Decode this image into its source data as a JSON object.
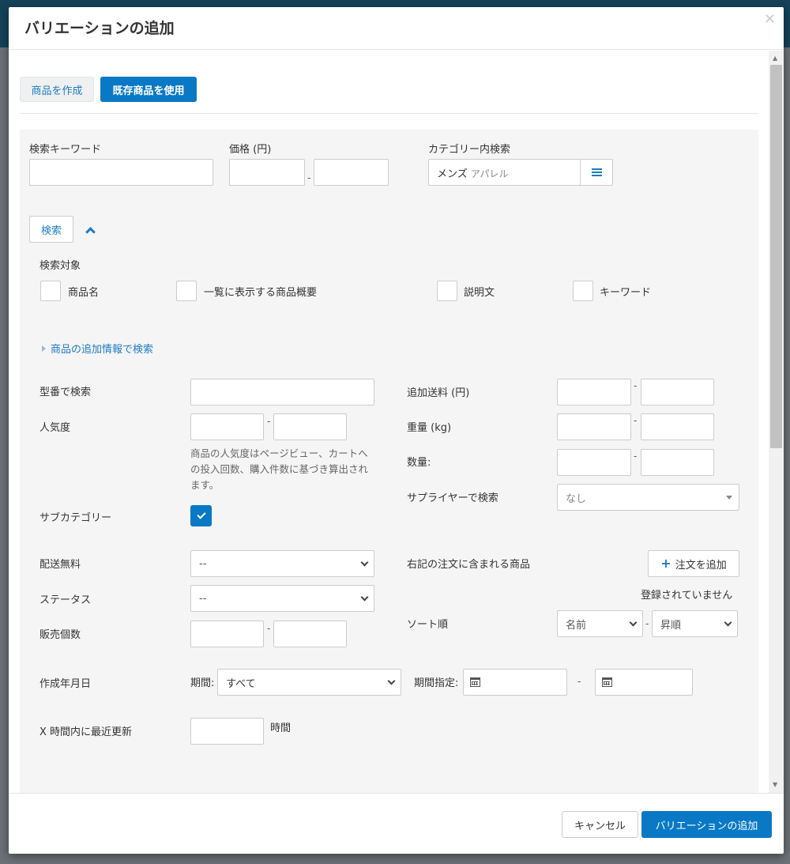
{
  "modal": {
    "title": "バリエーションの追加",
    "close": "×"
  },
  "tabs": {
    "create": "商品を作成",
    "existing": "既存商品を使用"
  },
  "search": {
    "keyword_label": "検索キーワード",
    "keyword_value": "",
    "price_label": "価格 (円)",
    "price_from": "",
    "price_to": "",
    "price_dash": "-",
    "category_label": "カテゴリー内検索",
    "category_main": "メンズ",
    "category_sub": "アパレル",
    "button": "検索"
  },
  "targets": {
    "label": "検索対象",
    "items": [
      "商品名",
      "一覧に表示する商品概要",
      "説明文",
      "キーワード"
    ]
  },
  "advanced": {
    "toggle": "商品の追加情報で検索",
    "model_label": "型番で検索",
    "popularity_label": "人気度",
    "popularity_hint": "商品の人気度はページビュー、カートへの投入回数、購入件数に基づき算出されます。",
    "subcategory_label": "サブカテゴリー",
    "free_shipping_label": "配送無料",
    "free_shipping_value": "--",
    "status_label": "ステータス",
    "status_value": "--",
    "sales_label": "販売個数",
    "shipping_label": "追加送料 (円)",
    "weight_label": "重量 (kg)",
    "quantity_label": "数量:",
    "supplier_label": "サプライヤーで検索",
    "supplier_value": "なし",
    "orders_label": "右記の注文に含まれる商品",
    "add_order_button": "注文を追加",
    "not_registered": "登録されていません",
    "sort_label": "ソート順",
    "sort_by": "名前",
    "sort_order": "昇順",
    "created_label": "作成年月日",
    "period_label": "期間:",
    "period_value": "すべて",
    "period_spec_label": "期間指定:",
    "updated_label": "X 時間内に最近更新",
    "hours_unit": "時間",
    "dash": "-"
  },
  "footer": {
    "cancel": "キャンセル",
    "submit": "バリエーションの追加"
  }
}
